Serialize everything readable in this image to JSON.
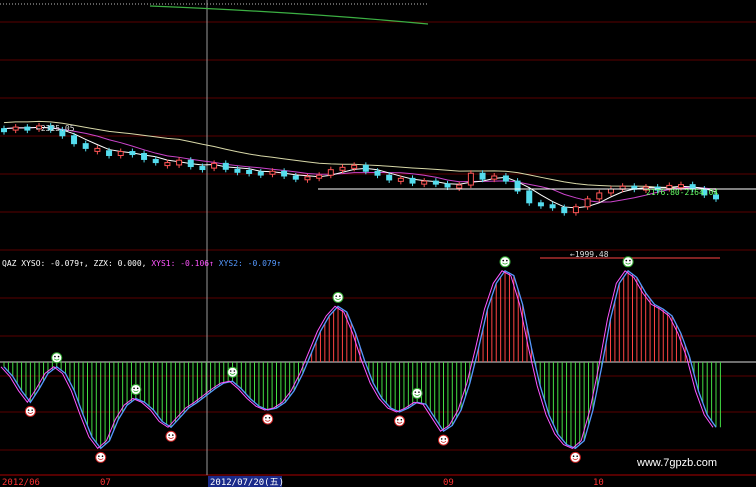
{
  "chart_data": {
    "type": "line",
    "price_panel": {
      "high_label": "2325.05",
      "low_label": "1999.48",
      "range_label": "2176.80-2164.04",
      "candles": [
        {
          "c": 2318,
          "up": false
        },
        {
          "c": 2322,
          "up": true
        },
        {
          "c": 2320,
          "up": false
        },
        {
          "c": 2325,
          "up": true
        },
        {
          "c": 2315,
          "up": false
        },
        {
          "c": 2300,
          "up": false
        },
        {
          "c": 2280,
          "up": false
        },
        {
          "c": 2268,
          "up": false
        },
        {
          "c": 2262,
          "up": true
        },
        {
          "c": 2250,
          "up": false
        },
        {
          "c": 2260,
          "up": true
        },
        {
          "c": 2255,
          "up": false
        },
        {
          "c": 2240,
          "up": false
        },
        {
          "c": 2232,
          "up": false
        },
        {
          "c": 2226,
          "up": true
        },
        {
          "c": 2238,
          "up": true
        },
        {
          "c": 2222,
          "up": false
        },
        {
          "c": 2218,
          "up": false
        },
        {
          "c": 2230,
          "up": true
        },
        {
          "c": 2215,
          "up": false
        },
        {
          "c": 2212,
          "up": false
        },
        {
          "c": 2208,
          "up": false
        },
        {
          "c": 2205,
          "up": false
        },
        {
          "c": 2210,
          "up": true
        },
        {
          "c": 2198,
          "up": false
        },
        {
          "c": 2190,
          "up": false
        },
        {
          "c": 2196,
          "up": true
        },
        {
          "c": 2200,
          "up": true
        },
        {
          "c": 2214,
          "up": true
        },
        {
          "c": 2220,
          "up": true
        },
        {
          "c": 2225,
          "up": true
        },
        {
          "c": 2210,
          "up": false
        },
        {
          "c": 2200,
          "up": false
        },
        {
          "c": 2188,
          "up": false
        },
        {
          "c": 2192,
          "up": true
        },
        {
          "c": 2180,
          "up": false
        },
        {
          "c": 2185,
          "up": true
        },
        {
          "c": 2178,
          "up": false
        },
        {
          "c": 2170,
          "up": false
        },
        {
          "c": 2175,
          "up": true
        },
        {
          "c": 2205,
          "up": true
        },
        {
          "c": 2190,
          "up": false
        },
        {
          "c": 2198,
          "up": true
        },
        {
          "c": 2185,
          "up": false
        },
        {
          "c": 2160,
          "up": false
        },
        {
          "c": 2130,
          "up": false
        },
        {
          "c": 2125,
          "up": false
        },
        {
          "c": 2118,
          "up": false
        },
        {
          "c": 2105,
          "up": false
        },
        {
          "c": 2120,
          "up": true
        },
        {
          "c": 2140,
          "up": true
        },
        {
          "c": 2155,
          "up": true
        },
        {
          "c": 2165,
          "up": true
        },
        {
          "c": 2172,
          "up": true
        },
        {
          "c": 2168,
          "up": false
        },
        {
          "c": 2170,
          "up": true
        },
        {
          "c": 2166,
          "up": false
        },
        {
          "c": 2174,
          "up": true
        },
        {
          "c": 2176,
          "up": true
        },
        {
          "c": 2165,
          "up": false
        },
        {
          "c": 2150,
          "up": false
        },
        {
          "c": 2140,
          "up": false
        }
      ]
    },
    "indicator_panel": {
      "legend": [
        {
          "text": "QAZ XYSO: -0.079↑, ZZX: 0.000,",
          "color": "#ffffff"
        },
        {
          "text": "XYS1: -0.106↑",
          "color": "#ff55ff"
        },
        {
          "text": "XYS2: -0.079↑",
          "color": "#5599ff"
        }
      ],
      "ylim": [
        -1.0,
        1.0
      ],
      "values": [
        -0.05,
        -0.15,
        -0.3,
        -0.42,
        -0.28,
        -0.12,
        -0.05,
        -0.12,
        -0.3,
        -0.55,
        -0.78,
        -0.9,
        -0.82,
        -0.6,
        -0.45,
        -0.38,
        -0.42,
        -0.5,
        -0.62,
        -0.68,
        -0.58,
        -0.48,
        -0.42,
        -0.35,
        -0.28,
        -0.22,
        -0.2,
        -0.28,
        -0.38,
        -0.46,
        -0.5,
        -0.48,
        -0.42,
        -0.3,
        -0.12,
        0.1,
        0.32,
        0.48,
        0.58,
        0.52,
        0.3,
        0.02,
        -0.22,
        -0.38,
        -0.48,
        -0.52,
        -0.48,
        -0.42,
        -0.44,
        -0.58,
        -0.72,
        -0.66,
        -0.5,
        -0.22,
        0.15,
        0.55,
        0.82,
        0.95,
        0.9,
        0.6,
        0.15,
        -0.25,
        -0.55,
        -0.75,
        -0.86,
        -0.9,
        -0.82,
        -0.5,
        -0.05,
        0.45,
        0.82,
        0.95,
        0.88,
        0.72,
        0.6,
        0.55,
        0.48,
        0.3,
        0.05,
        -0.3,
        -0.55,
        -0.68
      ]
    },
    "x_labels": [
      {
        "text": "2012/06",
        "color": "#ff3333"
      },
      {
        "text": "07",
        "color": "#ff3333"
      },
      {
        "text": "2012/07/20(五)",
        "color": "#ffffff",
        "highlight": true
      },
      {
        "text": "09",
        "color": "#ff3333"
      },
      {
        "text": "10",
        "color": "#ff3333"
      }
    ],
    "watermark": "www.7gpzb.com"
  }
}
